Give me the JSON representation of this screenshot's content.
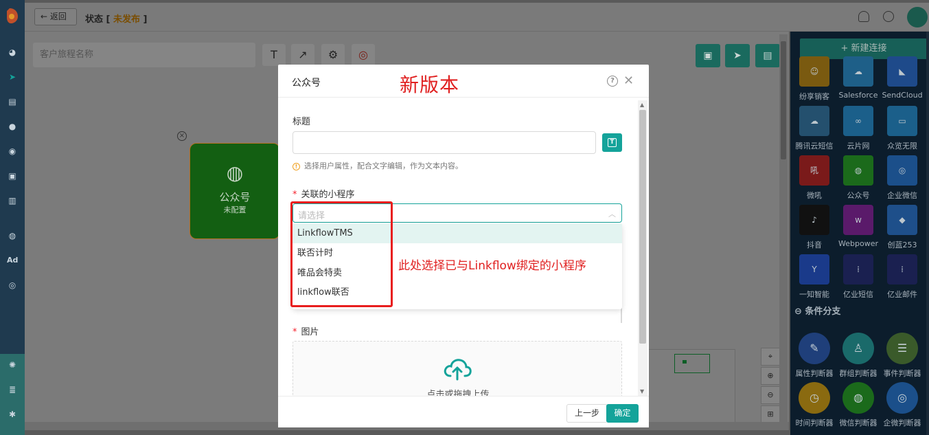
{
  "header": {
    "back_label": "返回",
    "status_label": "状态 [",
    "status_value": "未发布",
    "status_close": "]"
  },
  "canvas": {
    "name_placeholder": "客户旅程名称",
    "node": {
      "icon": "wechat-icon",
      "title": "公众号",
      "subtitle": "未配置"
    }
  },
  "right_panel": {
    "new_connection_label": "+ 新建连接",
    "connectors": [
      {
        "label": "纷享销客",
        "color": "#7a5a10"
      },
      {
        "label": "Salesforce",
        "color": "#1e5f88"
      },
      {
        "label": "SendCloud",
        "color": "#1e4a8a"
      },
      {
        "label": "腾讯云短信",
        "color": "#24506e"
      },
      {
        "label": "云片网",
        "color": "#1b5f8a"
      },
      {
        "label": "众览无限",
        "color": "#1b5f8a"
      },
      {
        "label": "微吼",
        "color": "#7a1a1a"
      },
      {
        "label": "公众号",
        "color": "#1b6a1b"
      },
      {
        "label": "企业微信",
        "color": "#1b4f8a"
      },
      {
        "label": "抖音",
        "color": "#111111"
      },
      {
        "label": "Webpower",
        "color": "#5a1a6a"
      },
      {
        "label": "创蓝253",
        "color": "#1e4f8a"
      },
      {
        "label": "一知智能",
        "color": "#1a3a8a"
      },
      {
        "label": "亿业短信",
        "color": "#1a2050"
      },
      {
        "label": "亿业邮件",
        "color": "#1a2050"
      }
    ],
    "section_title": "条件分支",
    "branches": [
      {
        "label": "属性判断器",
        "color": "#1f3f7a"
      },
      {
        "label": "群组判断器",
        "color": "#1a6a6a"
      },
      {
        "label": "事件判断器",
        "color": "#3a5a2a"
      },
      {
        "label": "时间判断器",
        "color": "#8a6a10"
      },
      {
        "label": "微信判断器",
        "color": "#1b6a1b"
      },
      {
        "label": "企微判断器",
        "color": "#1b4f8a"
      }
    ]
  },
  "modal": {
    "title": "公众号",
    "annotation_top": "新版本",
    "title_label": "标题",
    "title_value": "",
    "hint": "选择用户属性，配合文字编辑，作为文本内容。",
    "mini_program_label": "关联的小程序",
    "select_placeholder": "请选择",
    "options": [
      "LinkflowTMS",
      "联否计时",
      "唯品会特卖",
      "linkflow联否"
    ],
    "annotation_mid": "此处选择已与Linkflow绑定的小程序",
    "image_label": "图片",
    "upload_text": "点击或拖拽上传",
    "prev_label": "上一步",
    "confirm_label": "确定"
  }
}
